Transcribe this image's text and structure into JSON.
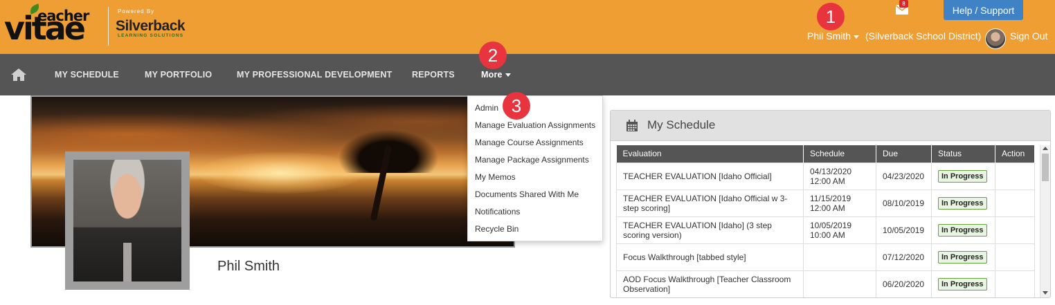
{
  "header": {
    "logo_main": "vitae",
    "logo_top": "eacher",
    "powered_by": "Powered By",
    "silverback": "Silverback",
    "silverback_sub": "LEARNING SOLUTIONS",
    "help_label": "Help / Support",
    "mail_count": "8",
    "user_name": "Phil Smith",
    "district": "(Silverback School District)",
    "sign_out": "Sign Out",
    "colors": {
      "bar": "#ef9e34",
      "help_button": "#3f82c6"
    }
  },
  "steps": [
    "1",
    "2",
    "3"
  ],
  "nav": {
    "home_icon": "home-icon",
    "items": [
      "MY SCHEDULE",
      "MY PORTFOLIO",
      "MY PROFESSIONAL DEVELOPMENT",
      "REPORTS"
    ],
    "more_label": "More"
  },
  "dropdown": {
    "items": [
      "Admin",
      "Manage Evaluation Assignments",
      "Manage Course Assignments",
      "Manage Package Assignments",
      "My Memos",
      "Documents Shared With Me",
      "Notifications",
      "Recycle Bin"
    ]
  },
  "profile": {
    "name": "Phil Smith"
  },
  "schedule": {
    "title": "My Schedule",
    "columns": [
      "Evaluation",
      "Schedule",
      "Due",
      "Status",
      "Action"
    ],
    "rows": [
      {
        "evaluation": "TEACHER EVALUATION [Idaho Official]",
        "schedule_date": "04/13/2020",
        "schedule_time": "12:00 AM",
        "due": "04/23/2020",
        "status": "In Progress"
      },
      {
        "evaluation": "TEACHER EVALUATION [Idaho Official w 3-step scoring]",
        "schedule_date": "11/15/2019",
        "schedule_time": "12:00 AM",
        "due": "08/10/2019",
        "status": "In Progress"
      },
      {
        "evaluation": "TEACHER EVALUATION [Idaho] (3 step scoring version)",
        "schedule_date": "10/05/2019",
        "schedule_time": "10:00 AM",
        "due": "10/05/2019",
        "status": "In Progress"
      },
      {
        "evaluation": "Focus Walkthrough [tabbed style]",
        "schedule_date": "",
        "schedule_time": "",
        "due": "07/12/2020",
        "status": "In Progress"
      },
      {
        "evaluation": "AOD Focus Walkthrough [Teacher Classroom Observation]",
        "schedule_date": "",
        "schedule_time": "",
        "due": "06/20/2020",
        "status": "In Progress"
      }
    ]
  }
}
